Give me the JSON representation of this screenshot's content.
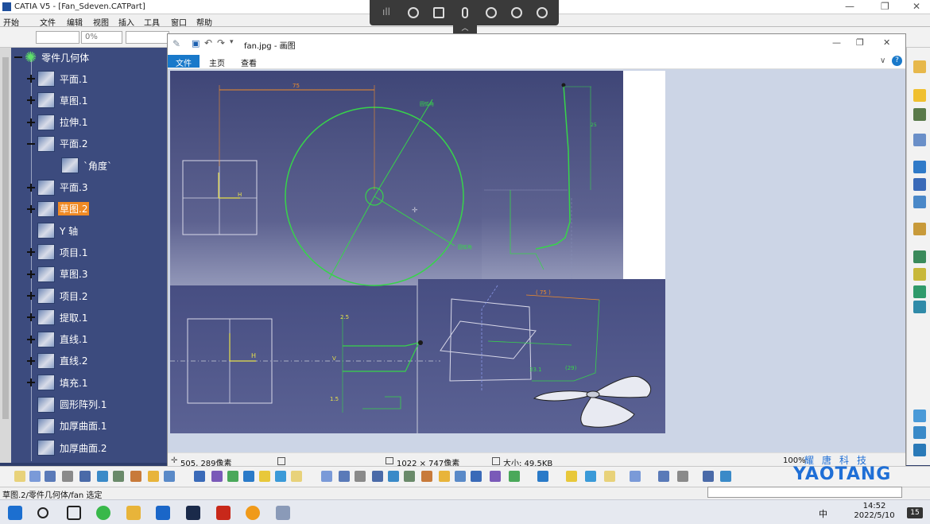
{
  "catia": {
    "title": "CATIA V5 - [Fan_Sdeven.CATPart]",
    "menu": [
      "开始",
      "文件",
      "编辑",
      "视图",
      "插入",
      "工具",
      "窗口",
      "帮助"
    ],
    "style_fields": {
      "color": "",
      "transparency": "0%",
      "linetype": ""
    },
    "status_text": "草图.2/零件几何体/fan 选定"
  },
  "tree": {
    "root": "零件几何体",
    "items": [
      {
        "label": "平面.1",
        "expand": "plus",
        "indent": 0,
        "selected": false
      },
      {
        "label": "草图.1",
        "expand": "plus",
        "indent": 0,
        "selected": false
      },
      {
        "label": "拉伸.1",
        "expand": "plus",
        "indent": 0,
        "selected": false
      },
      {
        "label": "平面.2",
        "expand": "minus",
        "indent": 0,
        "selected": false
      },
      {
        "label": "`角度`",
        "expand": "none",
        "indent": 1,
        "selected": false
      },
      {
        "label": "平面.3",
        "expand": "plus",
        "indent": 0,
        "selected": false
      },
      {
        "label": "草图.2",
        "expand": "plus",
        "indent": 0,
        "selected": true
      },
      {
        "label": "Y 轴",
        "expand": "none",
        "indent": 0,
        "selected": false
      },
      {
        "label": "项目.1",
        "expand": "plus",
        "indent": 0,
        "selected": false
      },
      {
        "label": "草图.3",
        "expand": "plus",
        "indent": 0,
        "selected": false
      },
      {
        "label": "项目.2",
        "expand": "plus",
        "indent": 0,
        "selected": false
      },
      {
        "label": "提取.1",
        "expand": "plus",
        "indent": 0,
        "selected": false
      },
      {
        "label": "直线.1",
        "expand": "plus",
        "indent": 0,
        "selected": false
      },
      {
        "label": "直线.2",
        "expand": "plus",
        "indent": 0,
        "selected": false
      },
      {
        "label": "填充.1",
        "expand": "plus",
        "indent": 0,
        "selected": false
      },
      {
        "label": "圆形阵列.1",
        "expand": "none",
        "indent": 0,
        "selected": false
      },
      {
        "label": "加厚曲面.1",
        "expand": "none",
        "indent": 0,
        "selected": false
      },
      {
        "label": "加厚曲面.2",
        "expand": "none",
        "indent": 0,
        "selected": false
      }
    ]
  },
  "paint": {
    "title": "fan.jpg - 画图",
    "tabs": [
      "文件",
      "主页",
      "查看"
    ],
    "status": {
      "cursor": "505, 289像素",
      "dimensions": "1022 × 747像素",
      "size": "大小: 49.5KB",
      "zoom": "100%"
    }
  },
  "drawing": {
    "dim_top": "75",
    "label_green1": "圆弧角",
    "label_green2": "圆弧角",
    "dim_right": "25",
    "dim_bottom_left_a": "2.5",
    "dim_bottom_left_b": "1.5",
    "dim_3d_top": "( 75 )",
    "dim_3d_a": "33.1",
    "dim_3d_b": "(29)",
    "h_label": "H",
    "v_label": "V"
  },
  "watermark": {
    "brand": "YAOTANG",
    "subtitle": "耀唐科技"
  },
  "taskbar": {
    "time": "14:52",
    "date": "2022/5/10",
    "ime": "中",
    "notifications": "15"
  },
  "colors": {
    "tree_bg": "#3c4b7e",
    "selection": "#f08a24",
    "accent": "#1979ca"
  }
}
